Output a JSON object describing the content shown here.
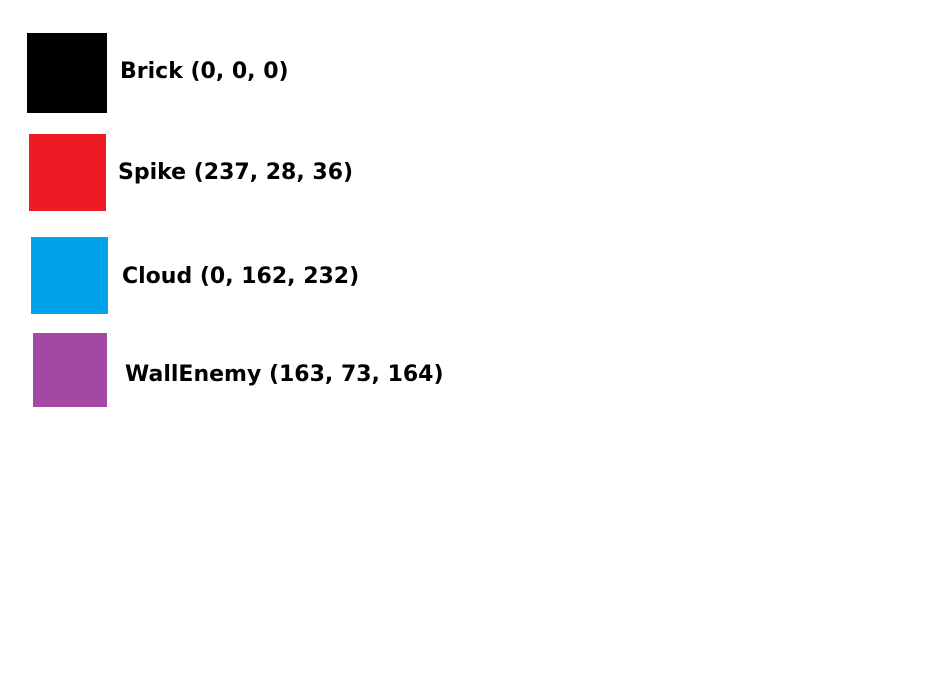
{
  "legend": {
    "items": [
      {
        "label": "Brick (0, 0, 0)",
        "color": "#000000"
      },
      {
        "label": "Spike (237, 28, 36)",
        "color": "#ED1C24"
      },
      {
        "label": "Cloud (0, 162, 232)",
        "color": "#00A2E8"
      },
      {
        "label": "WallEnemy (163, 73, 164)",
        "color": "#A349A4"
      }
    ]
  }
}
